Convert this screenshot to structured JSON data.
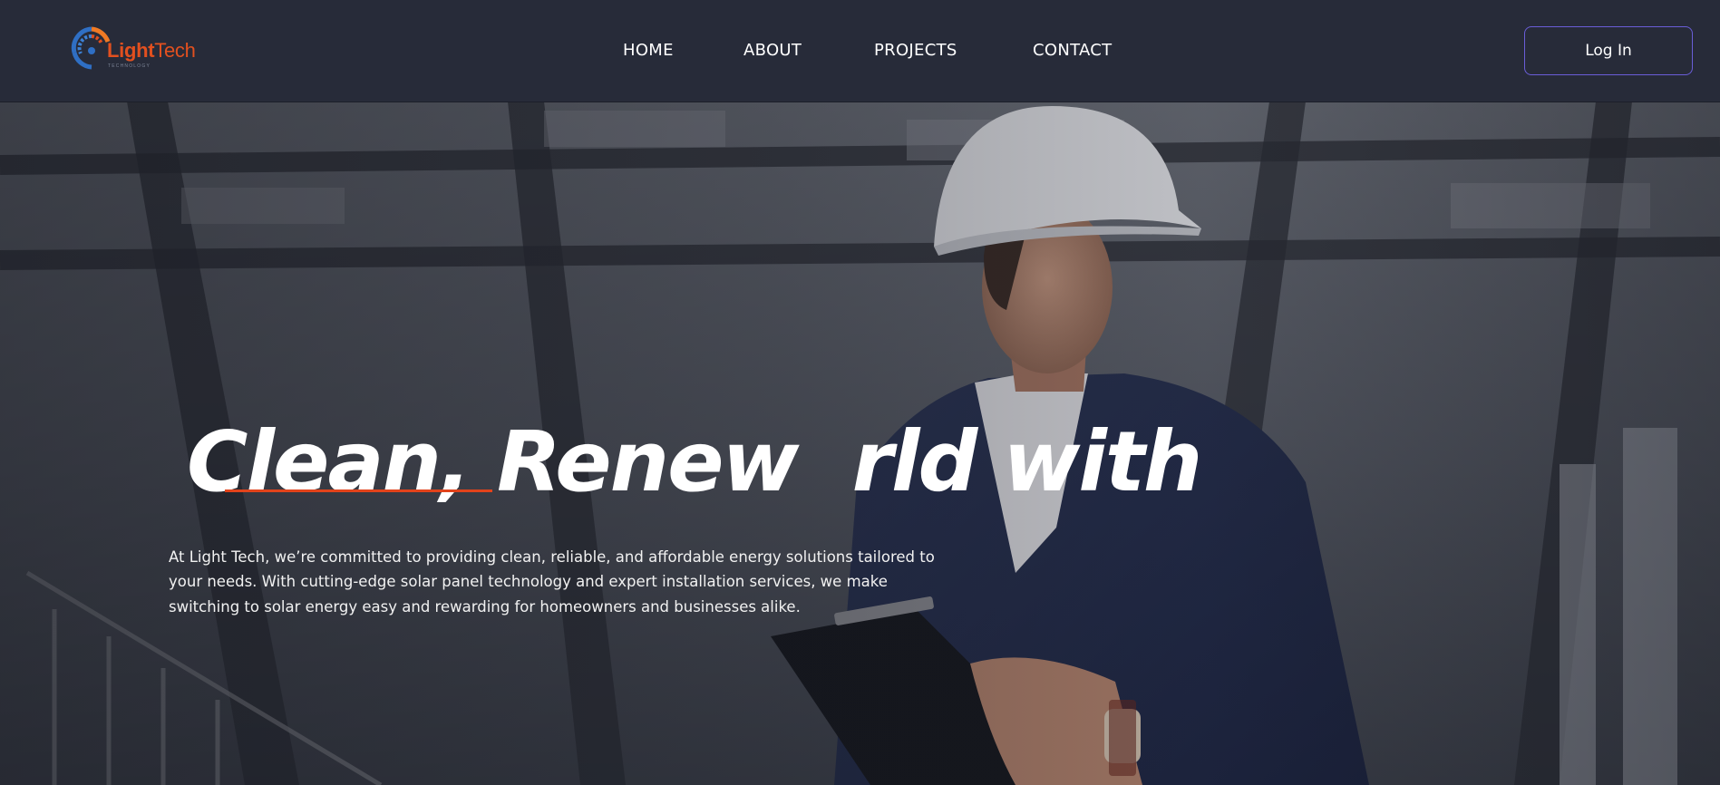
{
  "header": {
    "logo": {
      "name_bold": "Light",
      "name_regular": "Tech",
      "tagline": "TECHNOLOGY"
    },
    "nav": [
      {
        "label": "HOME"
      },
      {
        "label": "ABOUT"
      },
      {
        "label": "PROJECTS"
      },
      {
        "label": "CONTACT"
      }
    ],
    "login_label": "Log In"
  },
  "hero": {
    "headline": "Clean, Renew  rld with",
    "description": "At Light Tech, we’re committed to providing clean, reliable, and affordable energy solutions tailored to your needs. With cutting-edge solar panel technology and expert installation services, we make switching to solar energy easy and rewarding for homeowners and businesses alike.",
    "image_subject": "engineer-in-hard-hat-holding-clipboard"
  },
  "colors": {
    "header_bg": "#272b39",
    "accent_orange": "#e2431b",
    "logo_blue": "#2f6fc4",
    "login_border": "#6a5ed8",
    "text_white": "#ffffff"
  }
}
